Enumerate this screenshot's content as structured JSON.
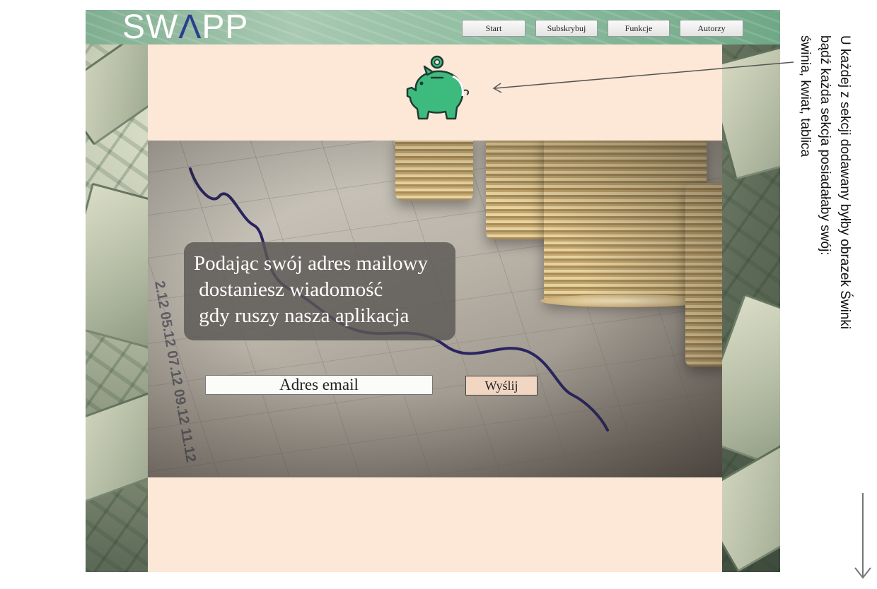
{
  "app": {
    "logo_main": "SW",
    "logo_accent": "Λ",
    "logo_end": "PP"
  },
  "nav": [
    {
      "label": "Start"
    },
    {
      "label": "Subskrybuj"
    },
    {
      "label": "Funkcje"
    },
    {
      "label": "Autorzy"
    }
  ],
  "hero": {
    "message": "Podając swój adres mailowy\n dostaniesz wiadomość\n gdy ruszy nasza aplikacja",
    "email_placeholder": "Adres email",
    "send_label": "Wyślij"
  },
  "annotation": {
    "text": "U każdej z sekcji dodawany byłby obrazek Świnki\nbądź każda sekcja posiadałaby swój:\nświnia, kwiat, tablica"
  },
  "icons": {
    "piggy": "piggy-bank-icon",
    "scroll": "arrow-down-icon"
  },
  "colors": {
    "panel": "#fde7d7",
    "piggy": "#3dbb7f",
    "logo_accent": "#2c3e8f",
    "send_button": "#f1d6c2"
  }
}
